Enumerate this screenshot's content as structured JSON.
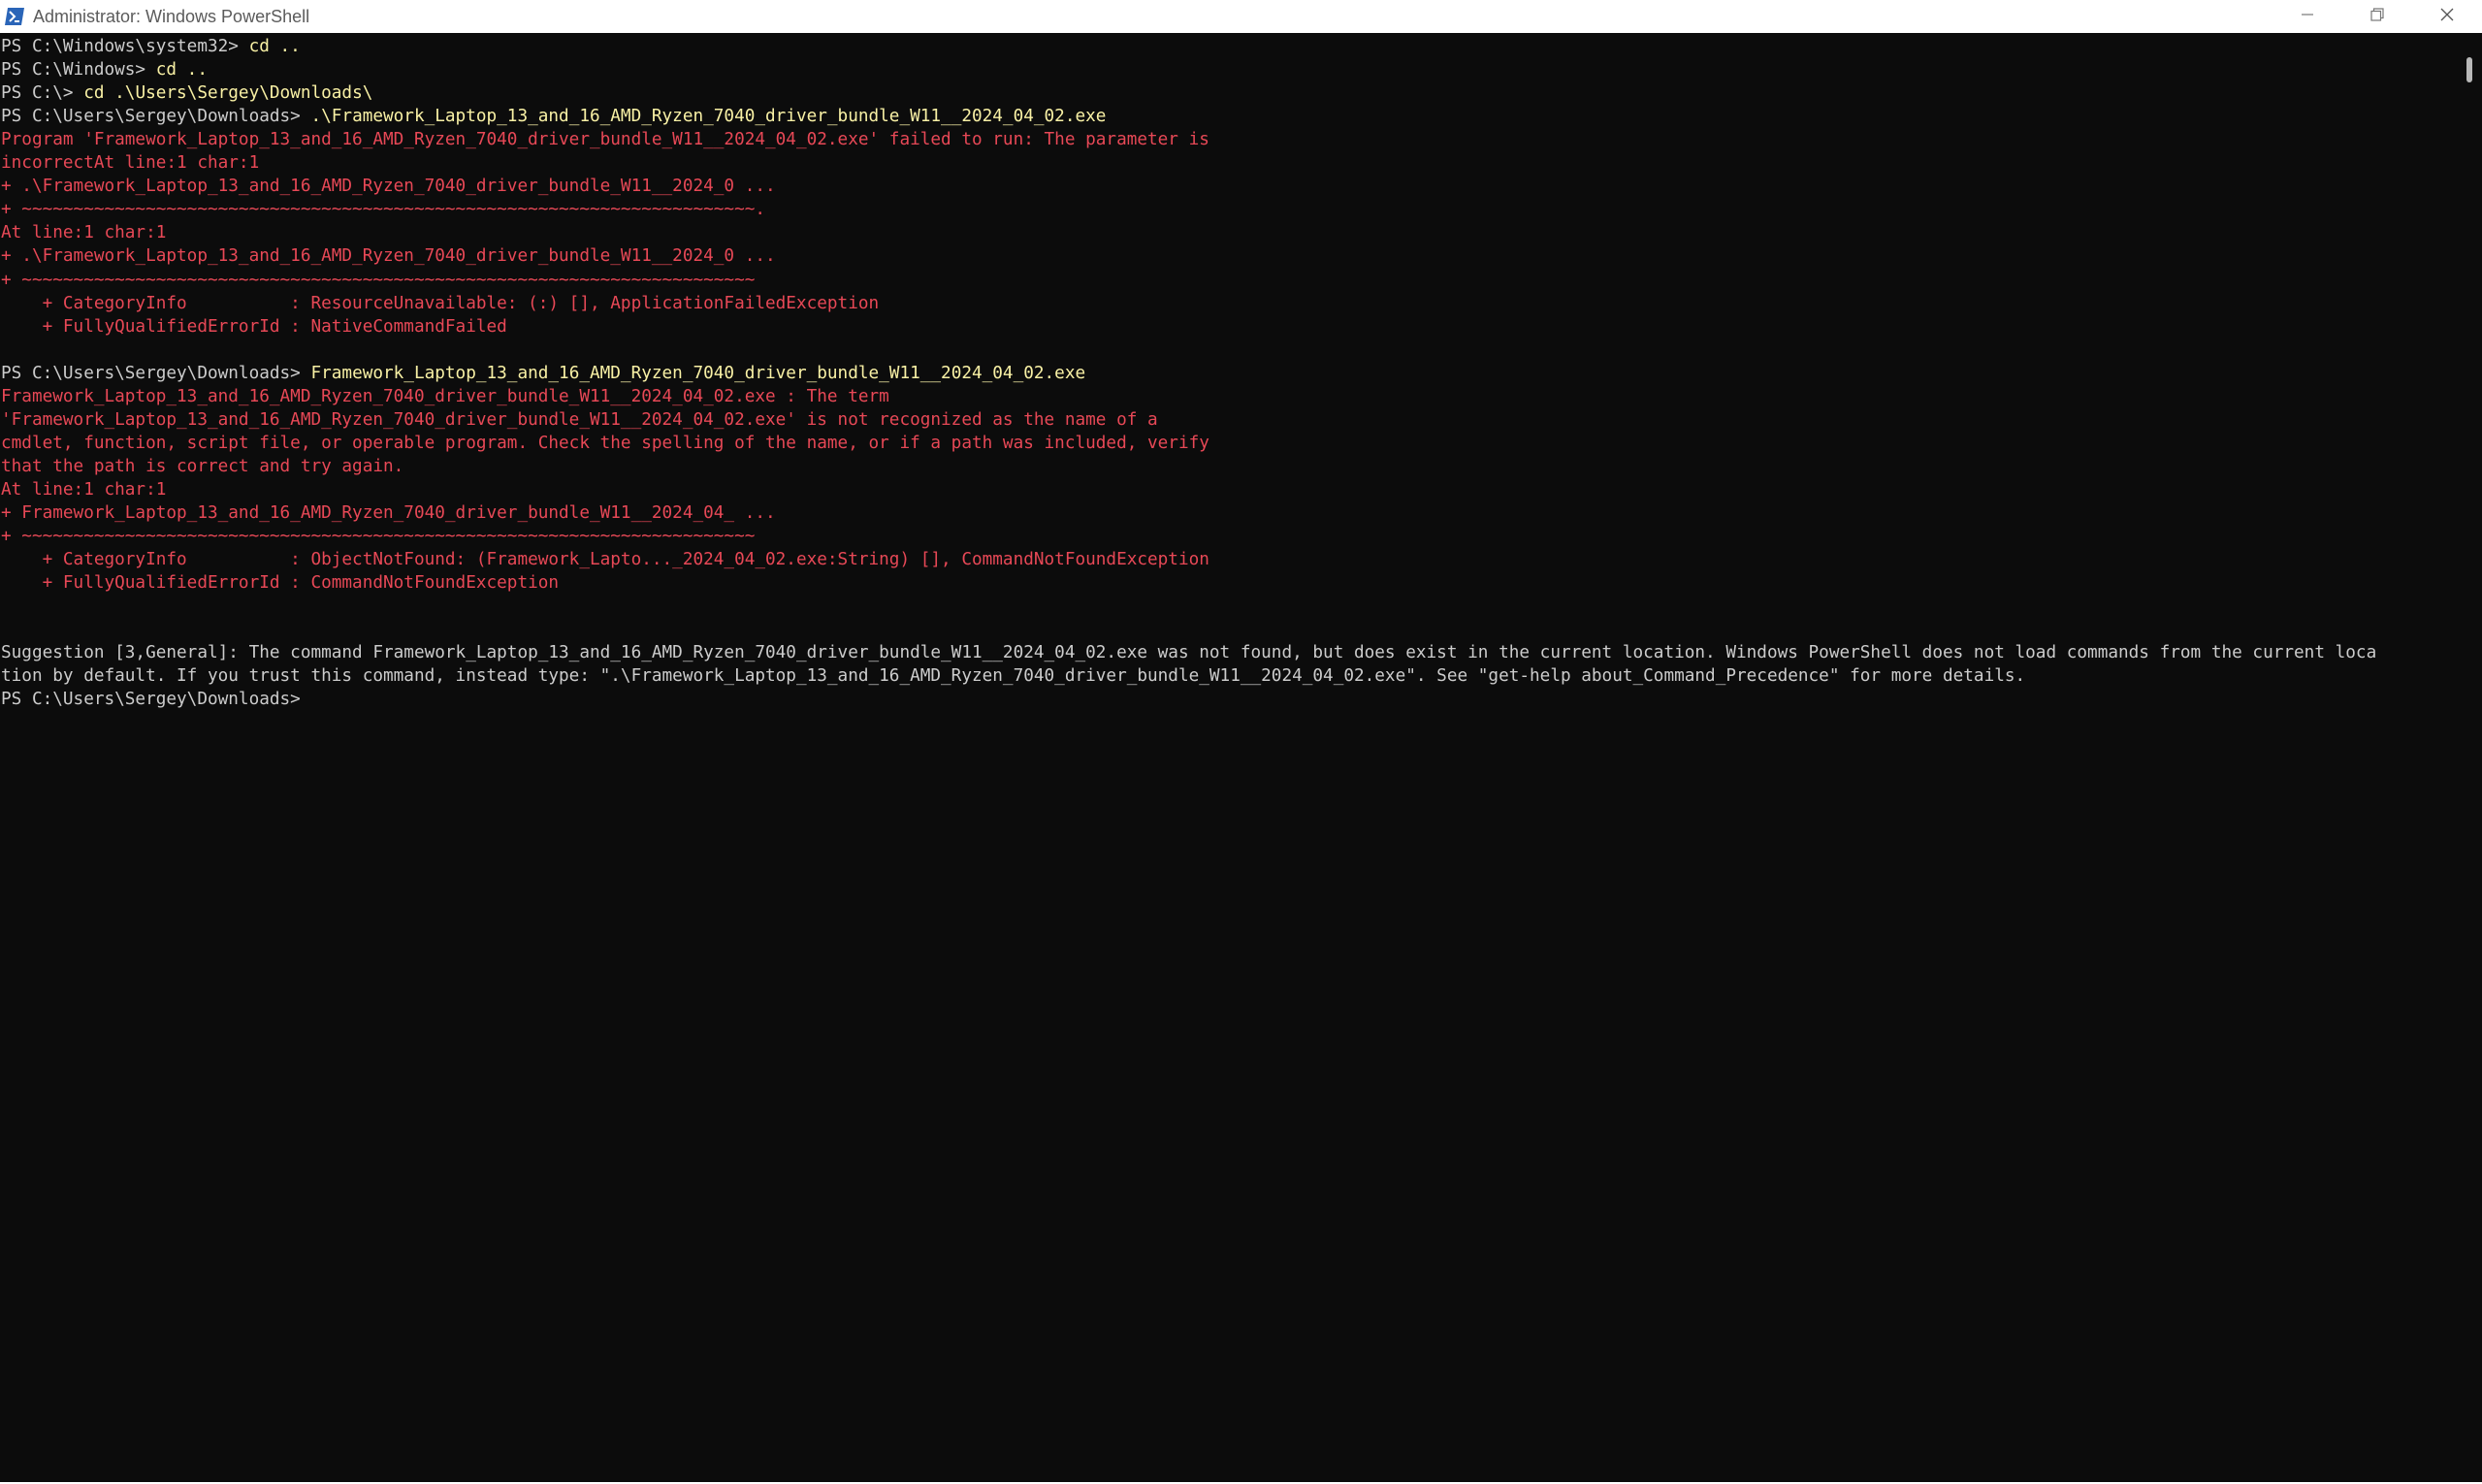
{
  "window": {
    "title": "Administrator: Windows PowerShell",
    "icon": "powershell-icon",
    "controls": [
      "minimize-icon",
      "restore-icon",
      "close-icon"
    ]
  },
  "colors": {
    "background": "#0c0c0c",
    "default_text": "#cccccc",
    "error_text": "#e74856",
    "command_text": "#f9f1a5"
  },
  "console": {
    "lines": [
      {
        "prompt": "PS C:\\Windows\\system32> ",
        "command": "cd ..",
        "text": ""
      },
      {
        "prompt": "PS C:\\Windows> ",
        "command": "cd ..",
        "text": ""
      },
      {
        "prompt": "PS C:\\> ",
        "command": "cd .\\Users\\Sergey\\Downloads\\",
        "text": ""
      },
      {
        "prompt": "PS C:\\Users\\Sergey\\Downloads> ",
        "command": ".\\Framework_Laptop_13_and_16_AMD_Ryzen_7040_driver_bundle_W11__2024_04_02.exe",
        "text": ""
      },
      {
        "prompt": "",
        "command": "",
        "text": "Program 'Framework_Laptop_13_and_16_AMD_Ryzen_7040_driver_bundle_W11__2024_04_02.exe' failed to run: The parameter is",
        "style": "err"
      },
      {
        "prompt": "",
        "command": "",
        "text": "incorrectAt line:1 char:1",
        "style": "err"
      },
      {
        "prompt": "",
        "command": "",
        "text": "+ .\\Framework_Laptop_13_and_16_AMD_Ryzen_7040_driver_bundle_W11__2024_0 ...",
        "style": "err"
      },
      {
        "prompt": "",
        "command": "",
        "text": "+ ~~~~~~~~~~~~~~~~~~~~~~~~~~~~~~~~~~~~~~~~~~~~~~~~~~~~~~~~~~~~~~~~~~~~~~~.",
        "style": "err"
      },
      {
        "prompt": "",
        "command": "",
        "text": "At line:1 char:1",
        "style": "err"
      },
      {
        "prompt": "",
        "command": "",
        "text": "+ .\\Framework_Laptop_13_and_16_AMD_Ryzen_7040_driver_bundle_W11__2024_0 ...",
        "style": "err"
      },
      {
        "prompt": "",
        "command": "",
        "text": "+ ~~~~~~~~~~~~~~~~~~~~~~~~~~~~~~~~~~~~~~~~~~~~~~~~~~~~~~~~~~~~~~~~~~~~~~~",
        "style": "err"
      },
      {
        "prompt": "",
        "command": "",
        "text": "    + CategoryInfo          : ResourceUnavailable: (:) [], ApplicationFailedException",
        "style": "err"
      },
      {
        "prompt": "",
        "command": "",
        "text": "    + FullyQualifiedErrorId : NativeCommandFailed",
        "style": "err"
      },
      {
        "prompt": "",
        "command": "",
        "text": ""
      },
      {
        "prompt": "PS C:\\Users\\Sergey\\Downloads> ",
        "command": "Framework_Laptop_13_and_16_AMD_Ryzen_7040_driver_bundle_W11__2024_04_02.exe",
        "text": ""
      },
      {
        "prompt": "",
        "command": "",
        "text": "Framework_Laptop_13_and_16_AMD_Ryzen_7040_driver_bundle_W11__2024_04_02.exe : The term",
        "style": "err"
      },
      {
        "prompt": "",
        "command": "",
        "text": "'Framework_Laptop_13_and_16_AMD_Ryzen_7040_driver_bundle_W11__2024_04_02.exe' is not recognized as the name of a",
        "style": "err"
      },
      {
        "prompt": "",
        "command": "",
        "text": "cmdlet, function, script file, or operable program. Check the spelling of the name, or if a path was included, verify",
        "style": "err"
      },
      {
        "prompt": "",
        "command": "",
        "text": "that the path is correct and try again.",
        "style": "err"
      },
      {
        "prompt": "",
        "command": "",
        "text": "At line:1 char:1",
        "style": "err"
      },
      {
        "prompt": "",
        "command": "",
        "text": "+ Framework_Laptop_13_and_16_AMD_Ryzen_7040_driver_bundle_W11__2024_04_ ...",
        "style": "err"
      },
      {
        "prompt": "",
        "command": "",
        "text": "+ ~~~~~~~~~~~~~~~~~~~~~~~~~~~~~~~~~~~~~~~~~~~~~~~~~~~~~~~~~~~~~~~~~~~~~~~",
        "style": "err"
      },
      {
        "prompt": "",
        "command": "",
        "text": "    + CategoryInfo          : ObjectNotFound: (Framework_Lapto..._2024_04_02.exe:String) [], CommandNotFoundException",
        "style": "err"
      },
      {
        "prompt": "",
        "command": "",
        "text": "    + FullyQualifiedErrorId : CommandNotFoundException",
        "style": "err"
      },
      {
        "prompt": "",
        "command": "",
        "text": ""
      },
      {
        "prompt": "",
        "command": "",
        "text": ""
      },
      {
        "prompt": "",
        "command": "",
        "text": "Suggestion [3,General]: The command Framework_Laptop_13_and_16_AMD_Ryzen_7040_driver_bundle_W11__2024_04_02.exe was not found, but does exist in the current location. Windows PowerShell does not load commands from the current loca"
      },
      {
        "prompt": "",
        "command": "",
        "text": "tion by default. If you trust this command, instead type: \".\\Framework_Laptop_13_and_16_AMD_Ryzen_7040_driver_bundle_W11__2024_04_02.exe\". See \"get-help about_Command_Precedence\" for more details."
      },
      {
        "prompt": "PS C:\\Users\\Sergey\\Downloads> ",
        "command": "",
        "text": ""
      }
    ]
  }
}
